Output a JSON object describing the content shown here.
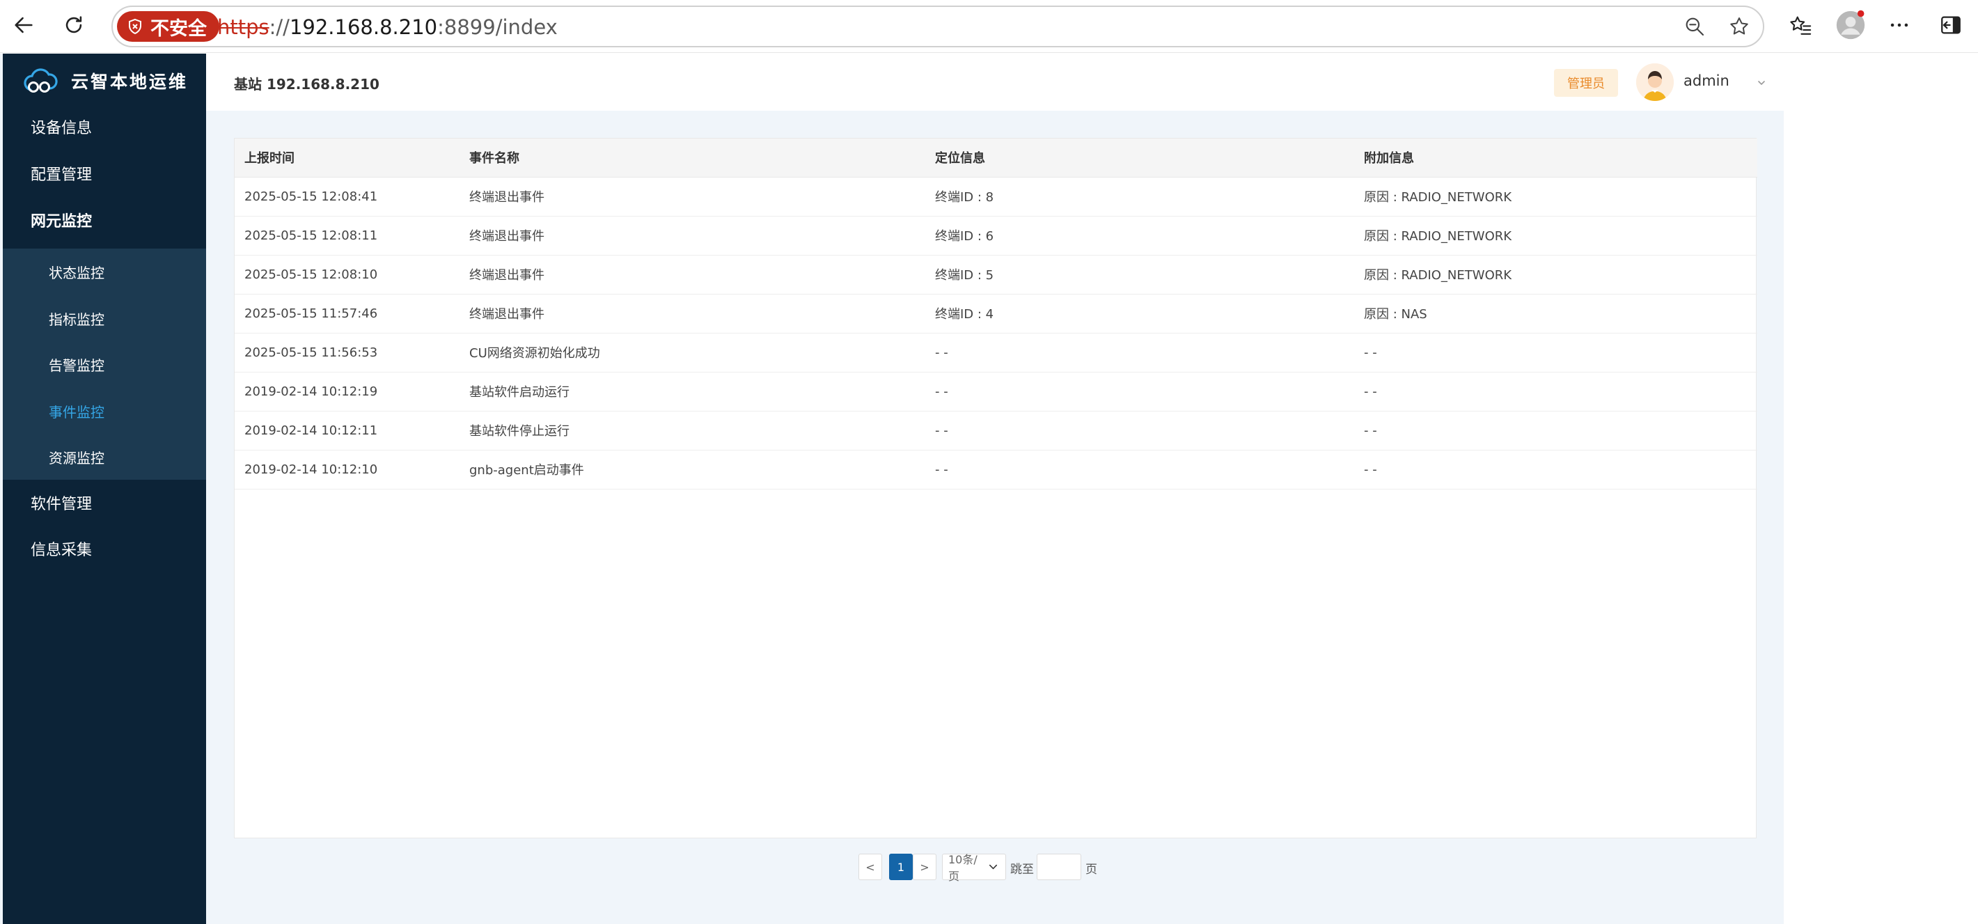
{
  "browser": {
    "insecure_label": "不安全",
    "url_protocol": "https",
    "url_host": "192.168.8.210",
    "url_rest": ":8899/index"
  },
  "app": {
    "name": "云智本地运维",
    "station": "基站 192.168.8.210",
    "role": "管理员",
    "user": "admin"
  },
  "sidebar": {
    "items": [
      {
        "label": "设备信息"
      },
      {
        "label": "配置管理"
      },
      {
        "label": "网元监控"
      },
      {
        "label": "软件管理"
      },
      {
        "label": "信息采集"
      }
    ],
    "sub_items": [
      {
        "label": "状态监控"
      },
      {
        "label": "指标监控"
      },
      {
        "label": "告警监控"
      },
      {
        "label": "事件监控"
      },
      {
        "label": "资源监控"
      }
    ]
  },
  "table": {
    "columns": [
      "上报时间",
      "事件名称",
      "定位信息",
      "附加信息"
    ],
    "rows": [
      [
        "2025-05-15 12:08:41",
        "终端退出事件",
        "终端ID : 8",
        "原因 : RADIO_NETWORK"
      ],
      [
        "2025-05-15 12:08:11",
        "终端退出事件",
        "终端ID : 6",
        "原因 : RADIO_NETWORK"
      ],
      [
        "2025-05-15 12:08:10",
        "终端退出事件",
        "终端ID : 5",
        "原因 : RADIO_NETWORK"
      ],
      [
        "2025-05-15 11:57:46",
        "终端退出事件",
        "终端ID : 4",
        "原因 : NAS"
      ],
      [
        "2025-05-15 11:56:53",
        "CU网络资源初始化成功",
        "- -",
        "- -"
      ],
      [
        "2019-02-14 10:12:19",
        "基站软件启动运行",
        "- -",
        "- -"
      ],
      [
        "2019-02-14 10:12:11",
        "基站软件停止运行",
        "- -",
        "- -"
      ],
      [
        "2019-02-14 10:12:10",
        "gnb-agent启动事件",
        "- -",
        "- -"
      ]
    ]
  },
  "pagination": {
    "prev": "<",
    "page": "1",
    "next": ">",
    "page_size": "10条/页",
    "jump_label": "跳至",
    "page_suffix": "页",
    "jump_value": ""
  },
  "colors": {
    "sidebar_bg": "#0c2337",
    "submenu_bg": "#1c3a51",
    "active_text": "#35a6e6",
    "content_bg": "#f0f5fa",
    "pager_active": "#1465a8",
    "insecure_red": "#c42b1c"
  }
}
